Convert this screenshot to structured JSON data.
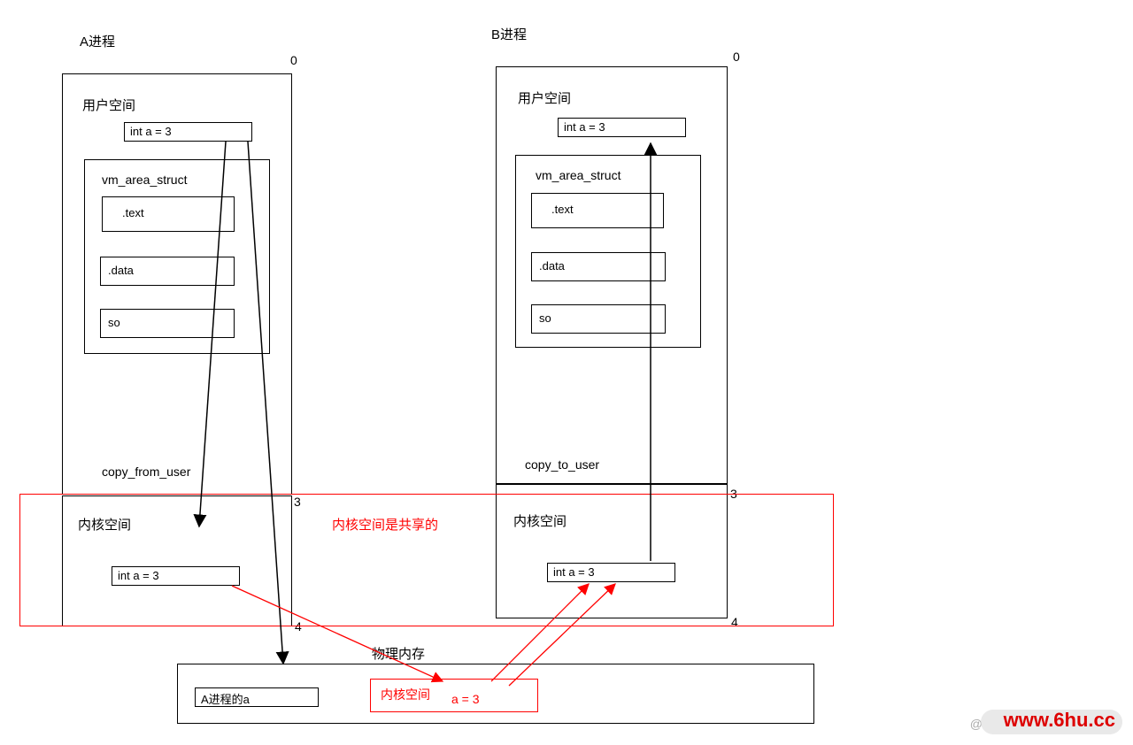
{
  "processA": {
    "title": "A进程",
    "marker_top": "0",
    "user_space_label": "用户空间",
    "int_a": "int a = 3",
    "vm_struct_label": "vm_area_struct",
    "text_seg": ".text",
    "data_seg": ".data",
    "so_seg": "so",
    "copy_label": "copy_from_user",
    "marker_3": "3",
    "kernel_label": "内核空间",
    "kernel_int_a": "int a = 3",
    "marker_4": "4"
  },
  "processB": {
    "title": "B进程",
    "marker_top": "0",
    "user_space_label": "用户空间",
    "int_a": "int a = 3",
    "vm_struct_label": "vm_area_struct",
    "text_seg": ".text",
    "data_seg": ".data",
    "so_seg": "so",
    "copy_label": "copy_to_user",
    "marker_3": "3",
    "kernel_label": "内核空间",
    "kernel_int_a": "int a = 3",
    "marker_4": "4"
  },
  "shared_kernel_note": "内核空间是共享的",
  "physical_memory": {
    "label": "物理内存",
    "a_box": "A进程的a",
    "kernel_box_label": "内核空间",
    "kernel_box_val": "a = 3"
  },
  "watermark": "www.6hu.cc",
  "watermark_at": "@"
}
